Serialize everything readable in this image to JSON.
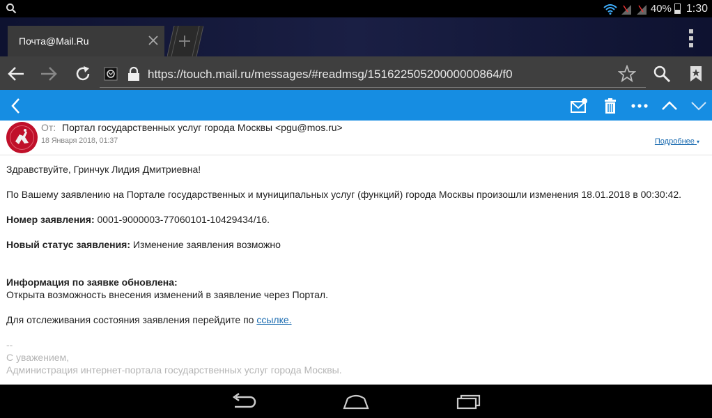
{
  "status": {
    "battery": "40%",
    "time": "1:30"
  },
  "tab": {
    "title": "Почта@Mail.Ru"
  },
  "address": {
    "url": "https://touch.mail.ru/messages/#readmsg/15162250520000000864/f0"
  },
  "message": {
    "from_label": "От:",
    "from_value": "Портал государственных услуг города Москвы <pgu@mos.ru>",
    "date": "18 Января 2018, 01:37",
    "more_link": "Подробнее",
    "greeting": "Здравствуйте, Гринчук Лидия Дмитриевна!",
    "intro": "По Вашему заявлению на Портале государственных и муниципальных услуг (функций) города Москвы произошли изменения 18.01.2018 в 00:30:42.",
    "number_label": "Номер заявления:",
    "number_value": "0001-9000003-77060101-10429434/16.",
    "status_label": "Новый статус заявления:",
    "status_value": "Изменение заявления возможно",
    "info_heading": "Информация по заявке обновлена:",
    "info_text": "Открыта возможность внесения изменений в заявление через Портал.",
    "tracking_text": "Для отслеживания состояния заявления перейдите по",
    "tracking_link": "ссылке.",
    "sig_dash": "--",
    "sig_regards": "С уважением,",
    "sig_org": "Администрация интернет-портала государственных услуг города Москвы."
  },
  "colors": {
    "mail_toolbar": "#168de2",
    "link": "#1a6bb0",
    "avatar_bg": "#c0102a"
  }
}
